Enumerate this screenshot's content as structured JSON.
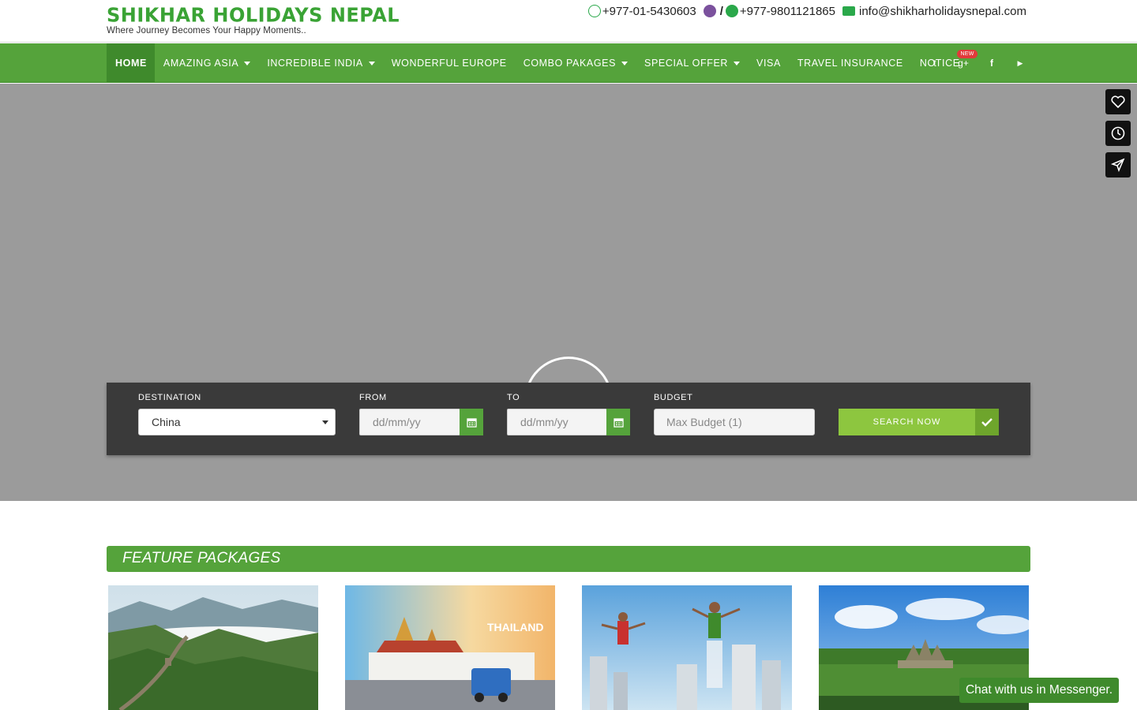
{
  "header": {
    "logo_title": "SHIKHAR HOLIDAYS NEPAL",
    "logo_tagline": "Where Journey Becomes Your Happy Moments..",
    "phone_landline": "+977-01-5430603",
    "separator": "/",
    "phone_mobile": "+977-9801121865",
    "email": "info@shikharholidaysnepal.com"
  },
  "nav": {
    "items": [
      {
        "label": "HOME",
        "active": true,
        "dropdown": false
      },
      {
        "label": "AMAZING ASIA",
        "dropdown": true
      },
      {
        "label": "INCREDIBLE INDIA",
        "dropdown": true
      },
      {
        "label": "WONDERFUL EUROPE",
        "dropdown": false
      },
      {
        "label": "COMBO PAKAGES",
        "dropdown": true
      },
      {
        "label": "SPECIAL OFFER",
        "dropdown": true
      },
      {
        "label": "VISA",
        "dropdown": false
      },
      {
        "label": "TRAVEL INSURANCE",
        "dropdown": false
      },
      {
        "label": "NOTICE",
        "dropdown": false,
        "badge": "NEW"
      }
    ],
    "social": [
      "twitter-icon",
      "google-plus-icon",
      "facebook-icon",
      "youtube-icon"
    ],
    "social_glyphs": {
      "twitter": "t",
      "google": "g+",
      "facebook": "f",
      "youtube": "▶"
    }
  },
  "search": {
    "destination_label": "DESTINATION",
    "destination_value": "China",
    "from_label": "FROM",
    "from_placeholder": "dd/mm/yy",
    "to_label": "TO",
    "to_placeholder": "dd/mm/yy",
    "budget_label": "BUDGET",
    "budget_placeholder": "Max Budget (1)",
    "submit_label": "SEARCH NOW"
  },
  "features": {
    "title": "FEATURE PACKAGES",
    "packages": [
      {
        "image": "great-wall-china"
      },
      {
        "image": "thailand-bangkok",
        "overlay_text": "THAILAND"
      },
      {
        "image": "dubai-flyboard"
      },
      {
        "image": "angkor-wat-cambodia"
      }
    ]
  },
  "messenger": {
    "label": "Chat with us in Messenger."
  },
  "colors": {
    "brand_green": "#55a33b",
    "dark_green": "#3f8a2c",
    "lime": "#8dc63f",
    "search_bg": "#3a3a3a",
    "hero_bg": "#9b9b9b"
  }
}
